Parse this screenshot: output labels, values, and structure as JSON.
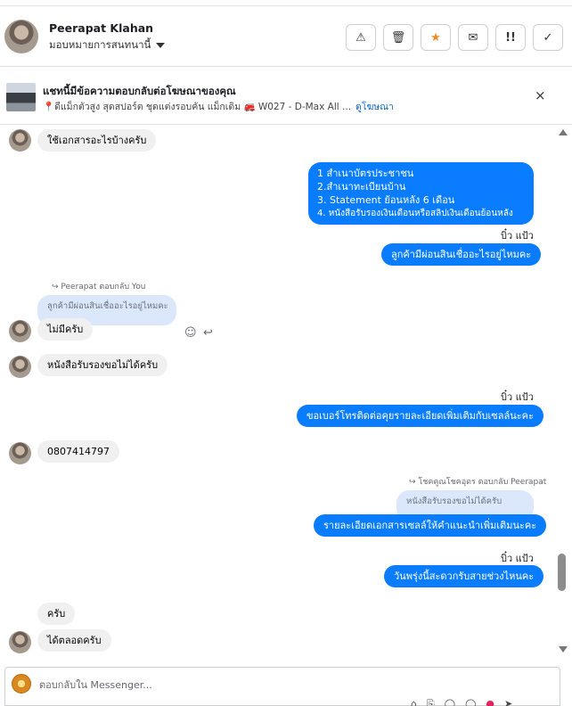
{
  "header": {
    "name": "Peerapat Klahan",
    "assign_label": "มอบหมายการสนทนานี้",
    "tools": [
      {
        "icon": "alert-icon",
        "glyph": "⚠"
      },
      {
        "icon": "trash-icon",
        "glyph": "🗑"
      },
      {
        "icon": "star-icon",
        "glyph": "★"
      },
      {
        "icon": "mark-unread-icon",
        "glyph": "✉"
      },
      {
        "icon": "follow-up-icon",
        "glyph": "!!"
      },
      {
        "icon": "done-check-icon",
        "glyph": "✓"
      }
    ]
  },
  "ad": {
    "title": "แชทนี้มีข้อความตอบกลับต่อโฆษณาของคุณ",
    "subtitle": "📍ดีแม็กตัวสูง สุดสปอร์ต ชุดแต่งรอบคัน แม็กเดิม 🚒 W027 - D-Max All ...",
    "link": "ดูโฆษณา",
    "close": "×"
  },
  "messages": {
    "m1": "ใช้เอกสารอะไรบ้างครับ",
    "m2_lines": [
      "1 สำเนาบัตรประชาชน",
      "2.สำเนาทะเบียนบ้าน",
      "3. Statement ย้อนหลัง 6 เดือน",
      "4. หนังสือรับรองเงินเดือนหรือสลิปเงินเดือนย้อนหลัง"
    ],
    "sender1": "บิ๋ว แป้ว",
    "m3": "ลูกค้ามีผ่อนสินเชื่ออะไรอยู่ไหมคะ",
    "reply_note1": "Peerapat ตอบกลับ You",
    "quote1": "ลูกค้ามีผ่อนสินเชื่ออะไรอยู่ไหมคะ",
    "m4": "ไม่มีครับ",
    "m5": "หนังสือรับรองขอไม่ได้ครับ",
    "sender2": "บิ๋ว แป้ว",
    "m6": "ขอเบอร์โทรติดต่อคุยรายละเอียดเพิ่มเติมกับเซลล์นะคะ",
    "m7": "0807414797",
    "reply_note2": "โชคคูณโชคอุดร ตอบกลับ Peerapat",
    "quote2": "หนังสือรับรองขอไม่ได้ครับ",
    "m8": "รายละเอียดเอกสารเซลล์ให้คำแนะนำเพิ่มเติมนะคะ",
    "sender3": "บิ๋ว แป้ว",
    "m9": "วันพรุ่งนี้สะดวกรับสายช่วงไหนคะ",
    "m10": "ครับ",
    "m11": "ได้ตลอดครับ"
  },
  "composer": {
    "placeholder": "ตอบกลับใน Messenger..."
  }
}
